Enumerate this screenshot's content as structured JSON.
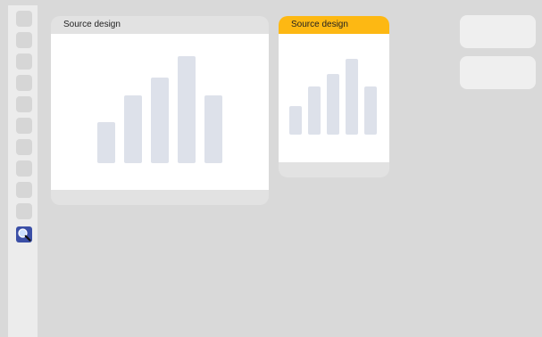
{
  "toolbar": {
    "tools": [
      {
        "icon": "tool-placeholder"
      },
      {
        "icon": "tool-placeholder"
      },
      {
        "icon": "tool-placeholder"
      },
      {
        "icon": "tool-placeholder"
      },
      {
        "icon": "tool-placeholder"
      },
      {
        "icon": "tool-placeholder"
      },
      {
        "icon": "tool-placeholder"
      },
      {
        "icon": "tool-placeholder"
      },
      {
        "icon": "tool-placeholder"
      },
      {
        "icon": "tool-placeholder"
      },
      {
        "icon": "magnifier-icon",
        "active": true
      }
    ]
  },
  "cards": [
    {
      "title": "Source design",
      "selected": false,
      "bars": [
        0.38,
        0.62,
        0.78,
        0.96,
        0.62
      ]
    },
    {
      "title": "Source design",
      "selected": true,
      "bars": [
        0.38,
        0.62,
        0.78,
        0.96,
        0.62
      ]
    }
  ],
  "colors": {
    "selected_header": "#fdb813",
    "active_tool": "#3b4fa6"
  }
}
